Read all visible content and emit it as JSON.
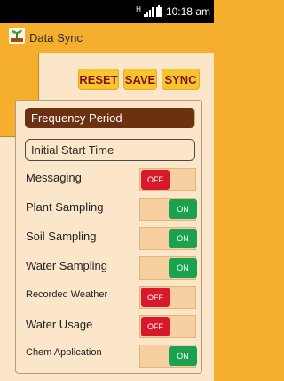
{
  "status_bar": {
    "time": "10:18 am",
    "signal_indicator": "H",
    "icons": [
      "signal-icon",
      "battery-icon"
    ]
  },
  "app_bar": {
    "title": "Data Sync",
    "logo_icon": "plant-logo-icon"
  },
  "actions": {
    "reset_label": "RESET",
    "save_label": "SAVE",
    "sync_label": "SYNC"
  },
  "settings": {
    "frequency_label": "Frequency Period",
    "start_time_label": "Initial Start Time"
  },
  "toggles": [
    {
      "label": "Messaging",
      "state": "OFF"
    },
    {
      "label": "Plant Sampling",
      "state": "ON"
    },
    {
      "label": "Soil Sampling",
      "state": "ON"
    },
    {
      "label": "Water Sampling",
      "state": "ON"
    },
    {
      "label": "Recorded Weather",
      "state": "OFF"
    },
    {
      "label": "Water Usage",
      "state": "OFF"
    },
    {
      "label": "Chem Application",
      "state": "ON"
    }
  ],
  "colors": {
    "app_bar": "#f6ae2d",
    "panel": "#fbe6c9",
    "button": "#f8c531",
    "button_text": "#7a1410",
    "frequency_button": "#6b3110",
    "toggle_on": "#1aa24f",
    "toggle_off": "#d8182b",
    "toggle_track": "#f7d0a2"
  }
}
